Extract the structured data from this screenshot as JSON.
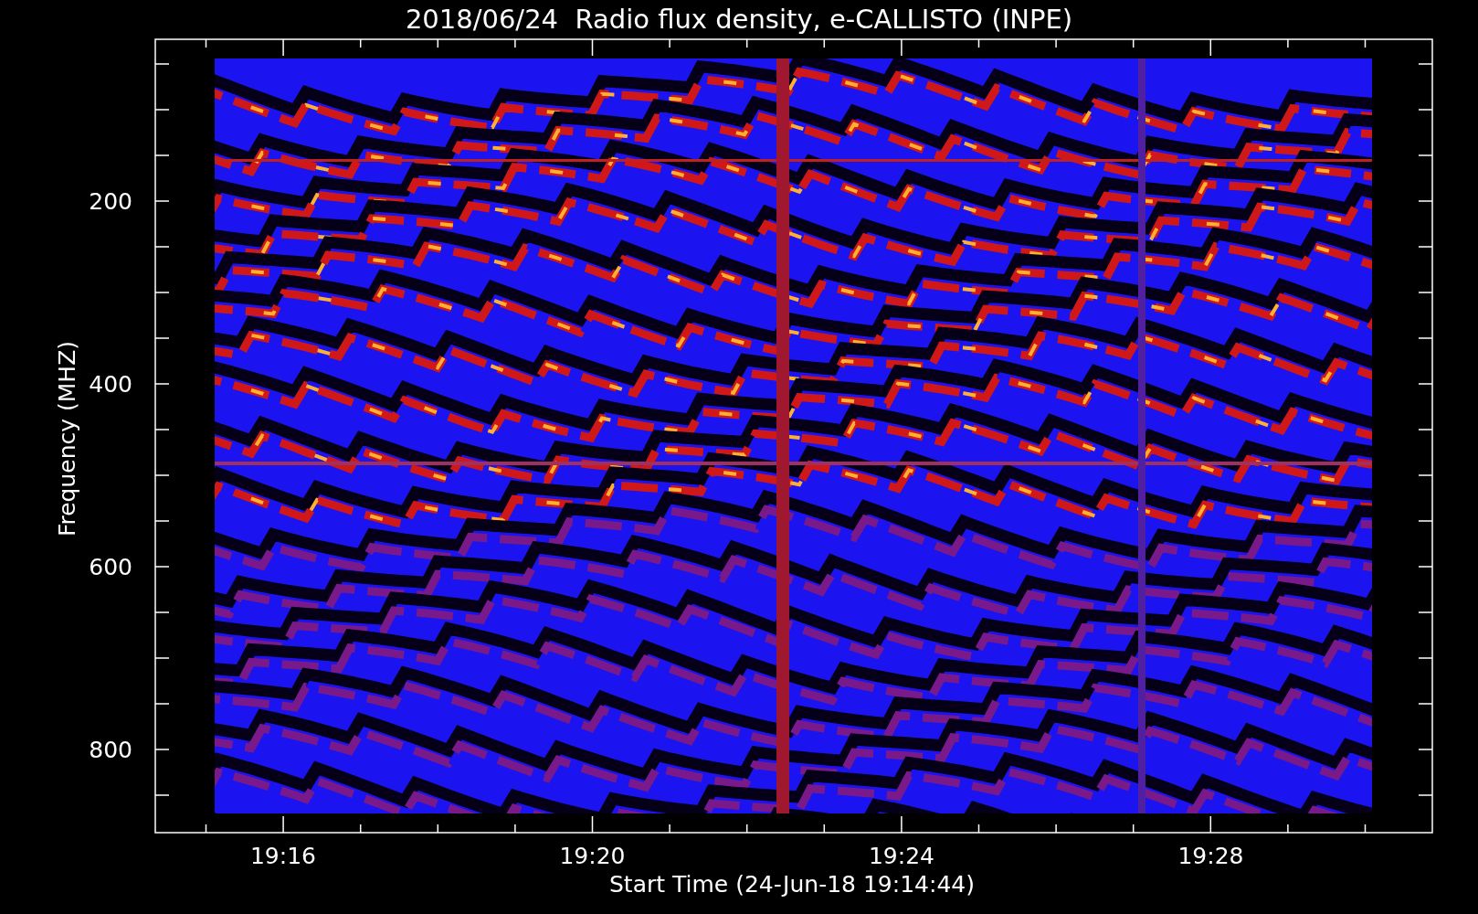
{
  "title": "2018/06/24  Radio flux density, e-CALLISTO (INPE)",
  "y_axis": {
    "label": "Frequency (MHZ)",
    "ticks": [
      "200",
      "400",
      "600",
      "800"
    ]
  },
  "x_axis": {
    "label": "Start Time (24-Jun-18 19:14:44)",
    "ticks": [
      "19:16",
      "19:20",
      "19:24",
      "19:28"
    ]
  }
}
